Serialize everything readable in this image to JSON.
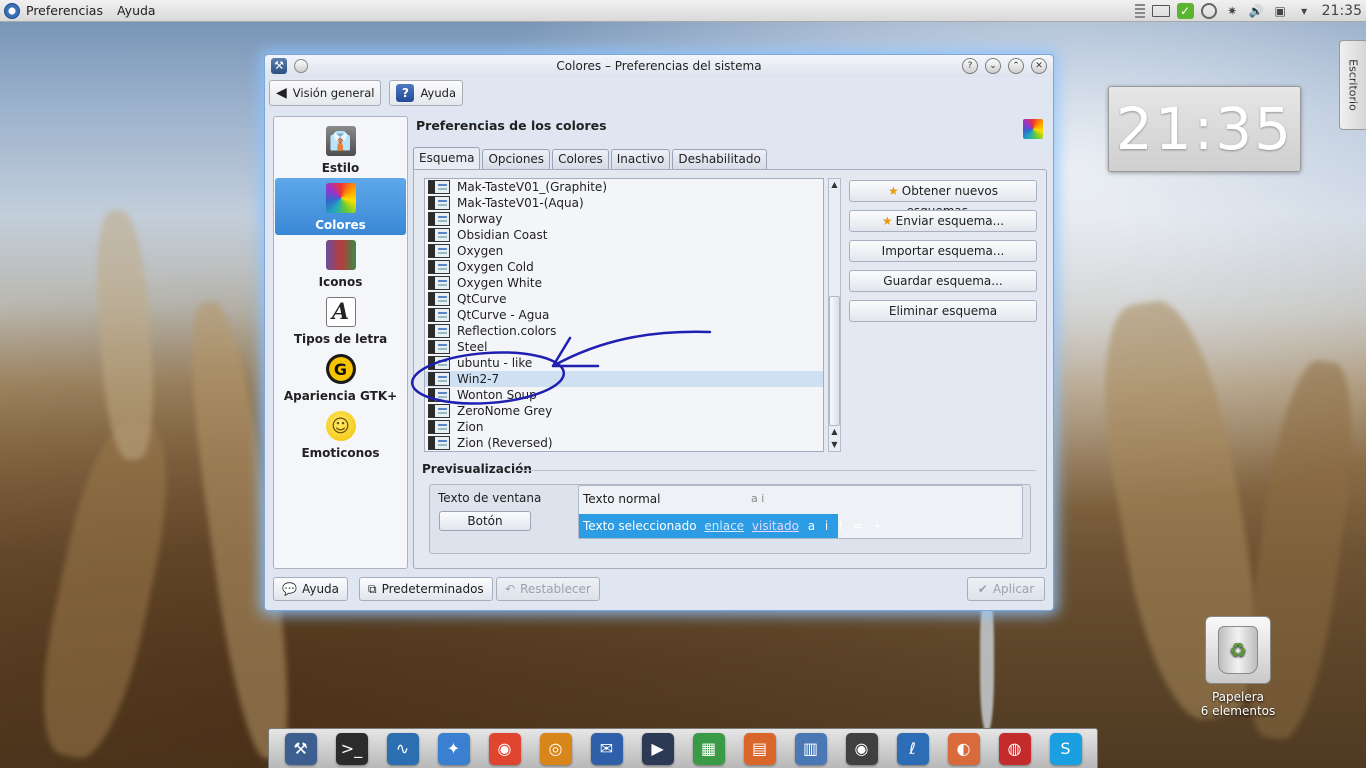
{
  "top_panel": {
    "menus": [
      "Preferencias",
      "Ayuda"
    ],
    "clock": "21:35"
  },
  "desktop": {
    "clock_widget": "21:35",
    "side_tab": "Escritorio",
    "trash": {
      "name": "Papelera",
      "count": "6 elementos"
    }
  },
  "window": {
    "title": "Colores – Preferencias del sistema",
    "toolbar": {
      "overview": "Visión general",
      "help": "Ayuda"
    },
    "sidebar": [
      {
        "label": "Estilo",
        "icon": "estilo-icon",
        "selected": false
      },
      {
        "label": "Colores",
        "icon": "colores-icon",
        "selected": true
      },
      {
        "label": "Iconos",
        "icon": "iconos-icon",
        "selected": false
      },
      {
        "label": "Tipos de letra",
        "icon": "tipos-icon",
        "selected": false
      },
      {
        "label": "Apariencia GTK+",
        "icon": "gtk-icon",
        "selected": false
      },
      {
        "label": "Emoticonos",
        "icon": "emoticonos-icon",
        "selected": false
      }
    ],
    "header": "Preferencias de los colores",
    "tabs": [
      "Esquema",
      "Opciones",
      "Colores",
      "Inactivo",
      "Deshabilitado"
    ],
    "active_tab": "Esquema",
    "schemes": [
      "Mak-TasteV01_(Graphite)",
      "Mak-TasteV01-(Aqua)",
      "Norway",
      "Obsidian Coast",
      "Oxygen",
      "Oxygen Cold",
      "Oxygen White",
      "QtCurve",
      "QtCurve - Agua",
      "Reflection.colors",
      "Steel",
      "ubuntu - like",
      "Win2-7",
      "Wonton Soup",
      "ZeroNome Grey",
      "Zion",
      "Zion (Reversed)"
    ],
    "selected_scheme": "Win2-7",
    "actions": {
      "get_new": "Obtener nuevos esquemas...",
      "send": "Enviar esquema...",
      "import": "Importar esquema...",
      "save": "Guardar esquema...",
      "delete": "Eliminar esquema"
    },
    "preview": {
      "label": "Previsualización",
      "window_text": "Texto de ventana",
      "button": "Botón",
      "normal_text": "Texto normal",
      "normal_suffix": "a  i",
      "selected_text": "Texto seleccionado",
      "link": "enlace",
      "visited": "visitado",
      "selected_suffix": "a i ! = +"
    },
    "bottom": {
      "help": "Ayuda",
      "defaults": "Predeterminados",
      "reset": "Restablecer",
      "apply": "Aplicar"
    }
  },
  "dock": {
    "apps": [
      "system-settings-icon",
      "terminal-icon",
      "system-monitor-icon",
      "browser-compass-icon",
      "chrome-icon",
      "eye-app-icon",
      "thunderbird-icon",
      "video-editor-icon",
      "spreadsheet-icon",
      "presentation-icon",
      "document-icon",
      "camera-icon",
      "graphics-icon",
      "eye-viewer-icon",
      "disc-burner-icon",
      "skype-icon"
    ]
  }
}
